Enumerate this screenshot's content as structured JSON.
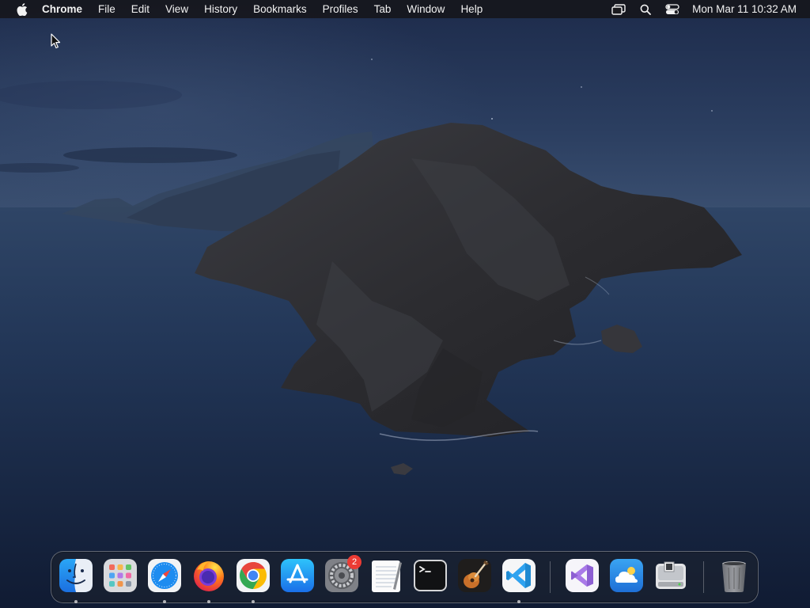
{
  "menubar": {
    "app_name": "Chrome",
    "items": [
      "File",
      "Edit",
      "View",
      "History",
      "Bookmarks",
      "Profiles",
      "Tab",
      "Window",
      "Help"
    ],
    "status_icons": [
      "screen-mirroring-icon",
      "spotlight-search-icon",
      "control-center-icon"
    ],
    "clock": "Mon Mar 11  10:32 AM"
  },
  "dock": {
    "apps": [
      {
        "name": "finder",
        "running": true
      },
      {
        "name": "launchpad",
        "running": false
      },
      {
        "name": "safari",
        "running": true
      },
      {
        "name": "firefox",
        "running": true
      },
      {
        "name": "chrome",
        "running": true
      },
      {
        "name": "app-store",
        "running": false
      },
      {
        "name": "system-preferences",
        "running": false,
        "badge": "2"
      },
      {
        "name": "textedit",
        "running": false
      },
      {
        "name": "terminal",
        "running": false
      },
      {
        "name": "garageband",
        "running": false
      },
      {
        "name": "vscode",
        "running": true
      },
      {
        "name": "visual-studio",
        "running": false
      },
      {
        "name": "cloud-app",
        "running": false
      },
      {
        "name": "disk-utility",
        "running": false
      },
      {
        "name": "trash",
        "running": false
      }
    ]
  },
  "colors": {
    "sky": "#24365a",
    "sea": "#1a2b4c",
    "island": "#2b2b2e",
    "badge": "#ec3b34"
  }
}
